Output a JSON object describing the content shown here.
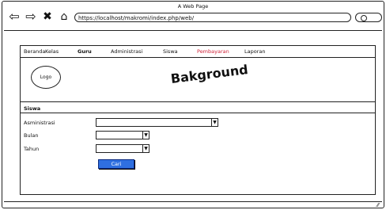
{
  "window": {
    "title": "A Web Page",
    "url": "https://localhost/makromi/index.php/web/"
  },
  "icons": {
    "back": "back-arrow-icon",
    "forward": "forward-arrow-icon",
    "close": "close-icon",
    "home": "home-icon",
    "search": "search-icon"
  },
  "menu": [
    "Beranda",
    "Kelas",
    "Guru",
    "Administrasi",
    "Siswa",
    "Pembayaran",
    "Laporan"
  ],
  "active_menu_color": "#d0243a",
  "header": {
    "logo": "Logo",
    "background_text": "Bakground"
  },
  "form": {
    "section_title": "Siswa",
    "fields": [
      {
        "label": "Asministrasi",
        "value": ""
      },
      {
        "label": "Bulan",
        "value": ""
      },
      {
        "label": "Tahun",
        "value": ""
      }
    ],
    "submit_label": "Cari",
    "submit_color": "#2f6fe0"
  }
}
